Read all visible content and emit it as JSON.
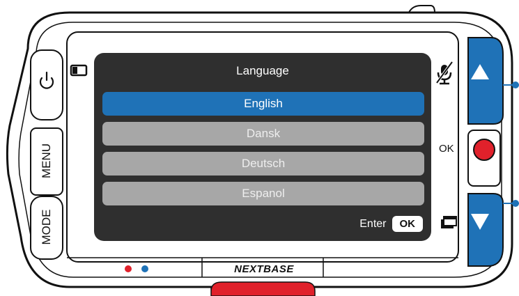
{
  "screen": {
    "title": "Language",
    "languages": [
      {
        "label": "English",
        "selected": true
      },
      {
        "label": "Dansk",
        "selected": false
      },
      {
        "label": "Deutsch",
        "selected": false
      },
      {
        "label": "Espanol",
        "selected": false
      }
    ],
    "enter_label": "Enter",
    "ok_key": "OK"
  },
  "buttons": {
    "menu_label": "MENU",
    "mode_label": "MODE",
    "ok_side_label": "OK"
  },
  "device": {
    "brand": "NEXTBASE"
  },
  "colors": {
    "accent_blue": "#1f72b7",
    "record_red": "#e0212b",
    "item_grey": "#a7a7a7",
    "screen_bg": "#2f2f2f"
  },
  "icons": [
    "power-icon",
    "microphone-muted-icon",
    "screen-icon",
    "protect-file-icon",
    "up-arrow-icon",
    "down-arrow-icon",
    "record-icon"
  ]
}
